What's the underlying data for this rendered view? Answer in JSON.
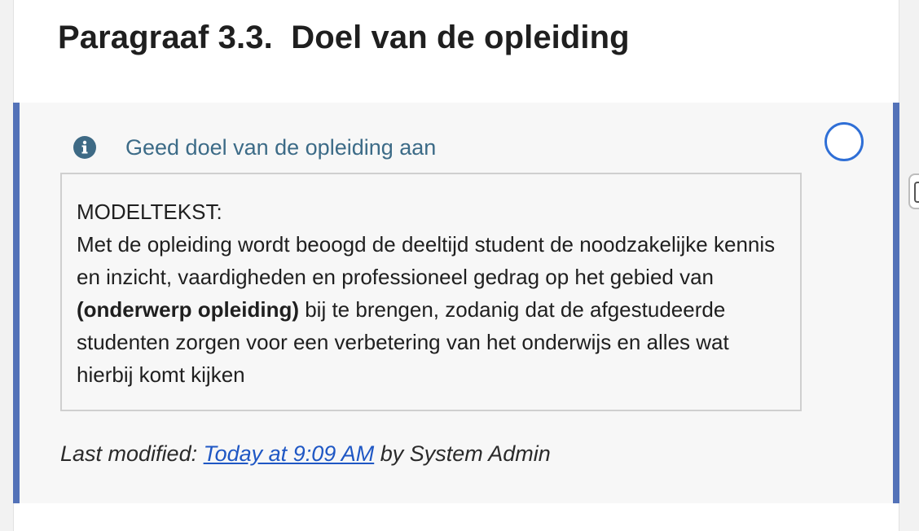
{
  "section": {
    "title": "Paragraaf 3.3.  Doel van de opleiding"
  },
  "item": {
    "prompt": "Geed doel van de opleiding aan",
    "model_text": {
      "heading": "MODELTEKST:",
      "before_bold": "Met de opleiding wordt beoogd de deeltijd student de noodzakelijke kennis en inzicht, vaardigheden en professioneel gedrag op het gebied van ",
      "bold": "(onderwerp opleiding)",
      "after_bold": " bij te brengen, zodanig dat de afgestudeerde studenten zorgen voor een verbetering van het onderwijs en alles wat hierbij komt kijken"
    },
    "last_modified": {
      "label": "Last modified: ",
      "link_text": "Today at 9:09 AM",
      "by_text": " by System Admin"
    },
    "status": "incomplete"
  },
  "colors": {
    "accent_border": "#5372b8",
    "prompt_text": "#3c6b87",
    "status_circle": "#2f6fd6",
    "link": "#1f57c4",
    "info_icon": "#3e6a85"
  },
  "icons": {
    "info": "info-circle-icon",
    "status": "empty-circle-icon",
    "side_handle": "side-panel-handle-icon"
  }
}
